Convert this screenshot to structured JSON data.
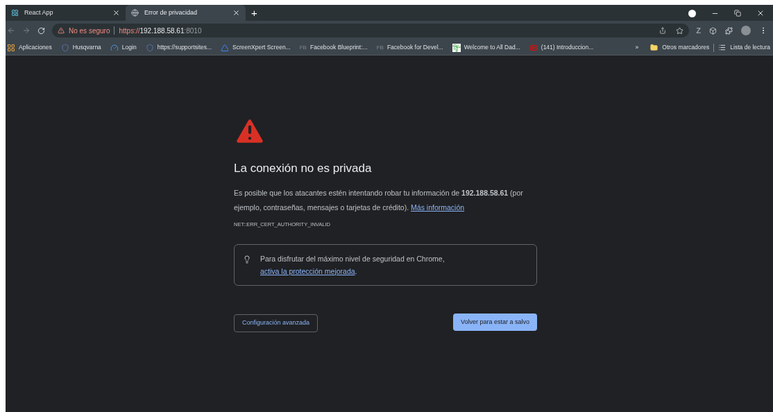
{
  "tabs": [
    {
      "title": "React App",
      "selected": false,
      "kind": "react"
    },
    {
      "title": "Error de privacidad",
      "selected": true,
      "kind": "globe"
    }
  ],
  "new_tab": "+",
  "address_bar": {
    "security": "No es seguro",
    "scheme": "https://",
    "host": "192.188.58.61",
    "port": ":8010"
  },
  "bookmarks": [
    {
      "label": "Aplicaciones",
      "kind": "apps"
    },
    {
      "label": "Husqvarna",
      "kind": "shield"
    },
    {
      "label": "Login",
      "kind": "badge"
    },
    {
      "label": "https://supportsites...",
      "kind": "shield"
    },
    {
      "label": "ScreenXpert Screen...",
      "kind": "triangle"
    },
    {
      "label": "Facebook Blueprint:...",
      "kind": "text",
      "icon_text": "FB"
    },
    {
      "label": "Facebook for Devel...",
      "kind": "text",
      "icon_text": "FB"
    },
    {
      "label": "Welcome to All Dad...",
      "kind": "palm"
    },
    {
      "label": "(141) Introduccion...",
      "kind": "video"
    }
  ],
  "extension_label": "Z",
  "bookmarks_more": "»",
  "other_bookmarks": "Otros marcadores",
  "reading_list": "Lista de lectura",
  "page": {
    "heading": "La conexión no es privada",
    "paragraph": "Es posible que los atacantes estén intentando robar tu información de **192.188.58.61** (por ejemplo, contraseñas, mensajes o tarjetas de crédito).",
    "paragraph_link": "Más información",
    "error_code": "NET::ERR_CERT_AUTHORITY_INVALID",
    "tip": "Para disfrutar del máximo nivel de seguridad en Chrome,",
    "tip_link": "activa la protección mejorada",
    "tip_end": ".",
    "advanced_button": "Configuración avanzada",
    "back_button": "Volver para estar a salvo"
  }
}
